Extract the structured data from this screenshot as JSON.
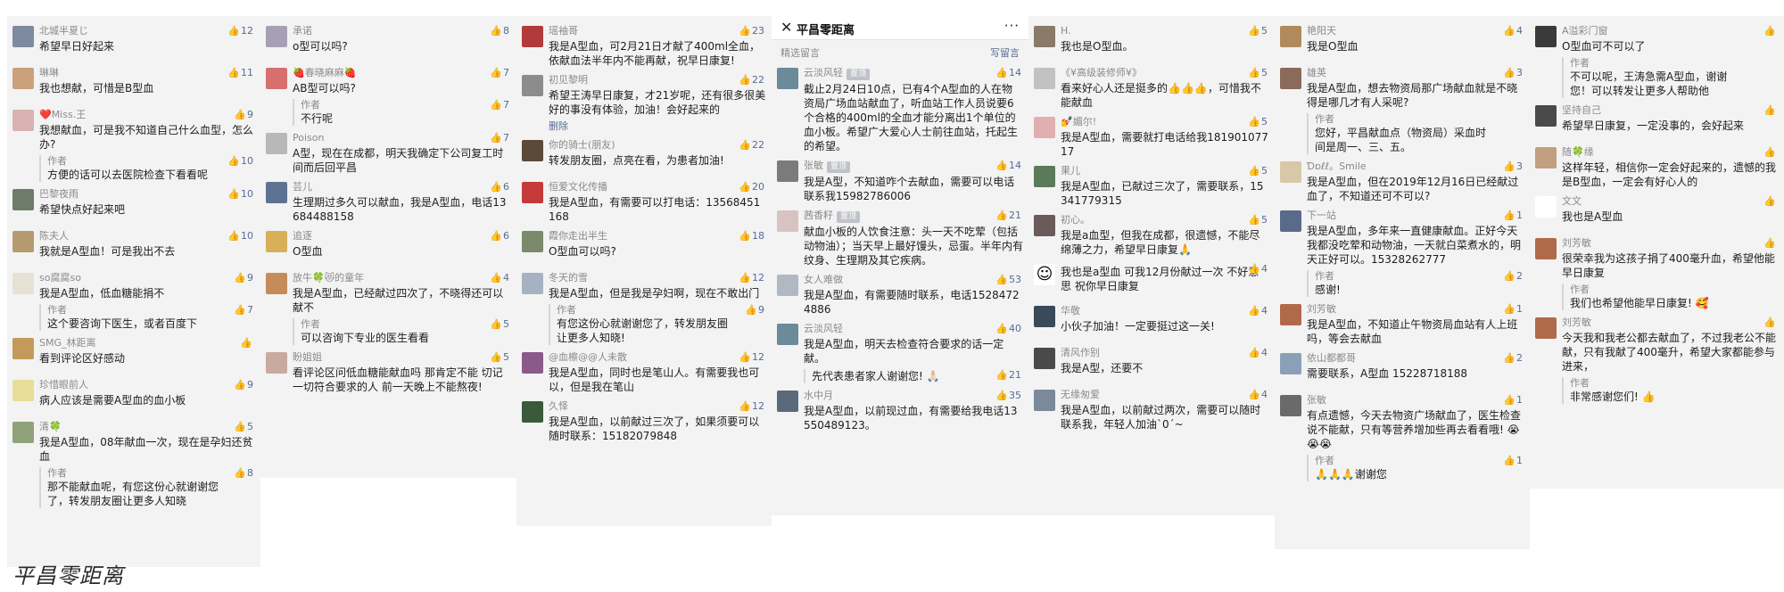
{
  "app_header": {
    "close_glyph": "✕",
    "title": "平昌零距离",
    "more_glyph": "···",
    "sub_left": "精选留言",
    "sub_right": "写留言"
  },
  "watermark": "平昌零距离",
  "icons": {
    "like": "thumbs-up-icon",
    "close": "close-icon",
    "more": "more-icon"
  },
  "colors": {
    "panel_bg": "#f3f3f3",
    "link": "#576b95",
    "name": "#8a8a8a"
  },
  "columns": [
    {
      "comments": [
        {
          "name": "北城半夏じ",
          "likes": "12",
          "text": "希望早日好起来",
          "avatar": "#7d8aa0"
        },
        {
          "name": "琳琳",
          "likes": "11",
          "text": "我也想献，可惜是B型血",
          "avatar": "#c9a27b"
        },
        {
          "name": "❤️Miss.王",
          "likes": "9",
          "text": "我想献血，可是我不知道自己什么血型，怎么办?",
          "avatar": "#d9b3b3",
          "reply_label": "作者",
          "reply_text": "方便的话可以去医院检查下看看呢",
          "reply_likes": "10"
        },
        {
          "name": "巴黎夜雨",
          "likes": "10",
          "text": "希望快点好起来吧",
          "avatar": "#6f7b6a"
        },
        {
          "name": "陈夫人",
          "likes": "10",
          "text": "我就是A型血！可是我出不去",
          "avatar": "#b49a6e"
        },
        {
          "name": "so腐腐so",
          "likes": "9",
          "text": "我是A型血，低血糖能捐不",
          "avatar": "#e7e0d4",
          "reply_label": "作者",
          "reply_text": "这个要咨询下医生，或者百度下",
          "reply_likes": "7"
        },
        {
          "name": "SMG_林距离",
          "likes": "",
          "text": "看到评论区好感动",
          "avatar": "#c49a5b"
        },
        {
          "name": "珍惜眼前人",
          "likes": "9",
          "text": "病人应该是需要A型血的血小板",
          "avatar": "#e9dd9a"
        },
        {
          "name": "清🍀",
          "likes": "5",
          "text": "我是A型血，08年献血一次，现在是孕妇还贫血",
          "avatar": "#8fa27a",
          "reply_label": "作者",
          "reply_text": "那不能献血呢，有您这份心就谢谢您了，转发朋友圈让更多人知晓",
          "reply_likes": "8"
        }
      ]
    },
    {
      "comments": [
        {
          "name": "承诺",
          "likes": "8",
          "text": "o型可以吗?",
          "avatar": "#a7a0b5"
        },
        {
          "name": "🍓春晓麻麻🍓",
          "likes": "7",
          "text": "AB型可以吗?",
          "avatar": "#d86f6f",
          "reply_label": "作者",
          "reply_text": "不行呢",
          "reply_likes": "7"
        },
        {
          "name": "Poison",
          "likes": "7",
          "text": "A型，现在在成都，明天我确定下公司复工时间而后回平昌",
          "avatar": "#b8b8b8"
        },
        {
          "name": "芸儿",
          "likes": "6",
          "text": "生理期过多久可以献血，我是A型血，电话13684488158",
          "avatar": "#5e7392"
        },
        {
          "name": "追逐",
          "likes": "6",
          "text": "O型血",
          "avatar": "#d8b05a"
        },
        {
          "name": "放牛🍀😻的童年",
          "likes": "4",
          "text": "我是A型血，已经献过四次了，不晓得还可以献不",
          "avatar": "#c58c5a",
          "reply_label": "作者",
          "reply_text": "可以咨询下专业的医生看看",
          "reply_likes": "5"
        },
        {
          "name": "盼姐姐",
          "likes": "5",
          "text": "看评论区问低血糖能献血吗 那肯定不能 切记一切符合要求的人 前一天晚上不能熬夜!",
          "avatar": "#caa9a0"
        }
      ]
    },
    {
      "comments": [
        {
          "name": "瑶袖哥",
          "likes": "23",
          "text": "我是A型血，可2月21日才献了400ml全血，依献血法半年内不能再献，祝早日康复!",
          "avatar": "#b23a3a"
        },
        {
          "name": "初见黎明",
          "likes": "22",
          "text": "希望王涛早日康复，才21岁呢，还有很多很美好的事没有体验，加油！会好起来的",
          "avatar": "#8c8c8c",
          "extra": "删除"
        },
        {
          "name": "你的骑士(朋友)",
          "likes": "22",
          "text": "转发朋友圈，点亮在看，为患者加油!",
          "avatar": "#5b4a3a"
        },
        {
          "name": "恒爱文化传播",
          "likes": "20",
          "text": "我是A型血，有需要可以打电话：13568451168",
          "avatar": "#c43a3a"
        },
        {
          "name": "霞你走出半生",
          "likes": "18",
          "text": "O型血可以吗?",
          "avatar": "#7a8a6a"
        },
        {
          "name": "冬天的雪",
          "likes": "12",
          "text": "我是A型血，但是我是孕妇啊，现在不敢出门",
          "avatar": "#a6b2c2",
          "reply_label": "作者",
          "reply_text": "有您这份心就谢谢您了，转发朋友圈让更多人知晓!",
          "reply_likes": "9"
        },
        {
          "name": "@血檫@@人未散",
          "likes": "12",
          "text": "我是A型血，同时也是笔山人。有需要我也可以，但是我在笔山",
          "avatar": "#8a5a8a"
        },
        {
          "name": "久怿",
          "likes": "12",
          "text": "我是A型血，以前献过三次了，如果须要可以随时联系：15182079848",
          "avatar": "#3a5a3a"
        }
      ]
    },
    {
      "header": true,
      "comments": [
        {
          "name": "云淡风轻",
          "tag": "置顶",
          "likes": "14",
          "text": "截止2月24日10点，已有4个A型血的人在物资局广场血站献血了，听血站工作人员说要6个合格的400ml的全血才能分离出1个单位的血小板。希望广大爱心人士前往血站，托起生的希望。",
          "avatar": "#6b8a9a"
        },
        {
          "name": "张敏",
          "tag": "置顶",
          "likes": "14",
          "text": "我是A型，不知道咋个去献血，需要可以电话联系我15982786006",
          "avatar": "#7b7b7b"
        },
        {
          "name": "茜香籽",
          "tag": "置顶",
          "likes": "21",
          "text": "献血小板的人饮食注意：头一天不吃荤（包括动物油）；当天早上最好馒头，忌蛋。半年内有纹身、生理期及其它疾病。",
          "avatar": "#d9c2c2"
        },
        {
          "name": "女人难做",
          "likes": "53",
          "text": "我是A型血，有需要随时联系，电话15284724886",
          "avatar": "#b0b8c2"
        },
        {
          "name": "云淡风轻",
          "likes": "40",
          "text": "我是A型血，明天去检查符合要求的话一定献。",
          "avatar": "#6b8a9a",
          "reply_label": "",
          "reply_text": "先代表患者家人谢谢您! 🙏🏻",
          "reply_likes": "21"
        },
        {
          "name": "水中月",
          "likes": "35",
          "text": "我是A型血，以前现过血，有需要给我电话13550489123。",
          "avatar": "#5a6a7a"
        }
      ]
    },
    {
      "comments": [
        {
          "name": "H.",
          "likes": "5",
          "text": "我也是O型血。",
          "avatar": "#8a7a6a"
        },
        {
          "name": "《¥高级装修师¥》",
          "likes": "5",
          "text": "看来好心人还是挺多的👍👍👍，可惜我不能献血",
          "avatar": "#c2c2c2"
        },
        {
          "name": "💅媚尔!",
          "likes": "5",
          "text": "我是A型血，需要就打电话给我18190107717",
          "avatar": "#e0b0b0"
        },
        {
          "name": "果儿",
          "likes": "5",
          "text": "我是A型血，已献过三次了，需要联系，15341779315",
          "avatar": "#5a7a5a"
        },
        {
          "name": "初心。",
          "likes": "5",
          "text": "我是a血型，但我在成都，很遗憾，不能尽绵薄之力，希望早日康复🙏",
          "avatar": "#6a5a5a"
        },
        {
          "name": "",
          "likes": "4",
          "text": "我也是a型血 可我12月份献过一次 不好意思 祝你早日康复",
          "avatar": "#ffffff",
          "avatar_glyph": "☺"
        },
        {
          "name": "华敬",
          "likes": "4",
          "text": "小伙子加油！一定要挺过这一关!",
          "avatar": "#3a4a5a"
        },
        {
          "name": "清风作别",
          "likes": "4",
          "text": "我是A型，还要不",
          "avatar": "#4a4a4a"
        },
        {
          "name": "无缘匆爱",
          "likes": "4",
          "text": "我是A型血，以前献过两次，需要可以随时联系我，年轻人加油ˋ0ˊ~",
          "avatar": "#7a8a9a"
        }
      ]
    },
    {
      "comments": [
        {
          "name": "艳阳天",
          "likes": "4",
          "text": "我是O型血",
          "avatar": "#b08a5a"
        },
        {
          "name": "雄英",
          "likes": "3",
          "text": "我是A型血，想去物资局那广场献血就是不晓得是哪几才有人采呢?",
          "avatar": "#8a6a5a",
          "reply_label": "作者",
          "reply_text": "您好，平昌献血点（物资局）采血时间是周一、三、五。",
          "reply_likes": ""
        },
        {
          "name": "Ɗɒℓℓ。Smile",
          "likes": "3",
          "text": "我是A型血，但在2019年12月16日已经献过血了，不知道还可不可以?",
          "avatar": "#d8c8a8"
        },
        {
          "name": "下一站",
          "likes": "1",
          "text": "我是A型血，多年来一直健康献血。正好今天我都没吃荤和动物油，一天就白菜煮水的，明天正好可以。15328262777",
          "avatar": "#5a6a8a",
          "reply_label": "作者",
          "reply_text": "感谢!",
          "reply_likes": "2"
        },
        {
          "name": "刘芳敏",
          "likes": "1",
          "text": "我是A型血，不知道止午物资局血站有人上班吗，等会去献血",
          "avatar": "#b06a4a"
        },
        {
          "name": "依山都都哥",
          "likes": "2",
          "text": "需要联系，A型血 15228718188",
          "avatar": "#8aa0b8"
        },
        {
          "name": "张敏",
          "likes": "1",
          "text": "有点遗憾，今天去物资广场献血了，医生检查说不能献，只有等营养增加些再去看看哦! 😭😭😭",
          "avatar": "#6a6a6a",
          "reply_label": "作者",
          "reply_text": "🙏🙏🙏谢谢您",
          "reply_likes": "1"
        }
      ]
    },
    {
      "comments": [
        {
          "name": "A溢彩门窗",
          "likes": "",
          "text": "O型血可不可以了",
          "avatar": "#3a3a3a",
          "reply_label": "作者",
          "reply_text": "不可以呢，王涛急需A型血，谢谢您！可以转发让更多人帮助他",
          "reply_likes": ""
        },
        {
          "name": "坚持自己",
          "likes": "",
          "text": "希望早日康复，一定没事的，会好起来",
          "avatar": "#4a4a4a"
        },
        {
          "name": "随🍀缘",
          "likes": "",
          "text": "这样年轻，相信你一定会好起来的，遗憾的我是B型血，一定会有好心人的",
          "avatar": "#c0a080"
        },
        {
          "name": "文文",
          "likes": "",
          "text": "我也是A型血",
          "avatar": "#ffffff"
        },
        {
          "name": "刘芳敏",
          "likes": "",
          "text": "很荣幸我为这孩子捐了400毫升血，希望他能早日康复",
          "avatar": "#b06a4a",
          "reply_label": "作者",
          "reply_text": "我们也希望他能早日康复! 🥰",
          "reply_likes": ""
        },
        {
          "name": "刘芳敏",
          "likes": "",
          "text": "今天我和我老公都去献血了，不过我老公不能献，只有我献了400毫升，希望大家都能参与进来，",
          "avatar": "#b06a4a",
          "reply_label": "作者",
          "reply_text": "非常感谢您们! 👍",
          "reply_likes": ""
        }
      ]
    }
  ]
}
